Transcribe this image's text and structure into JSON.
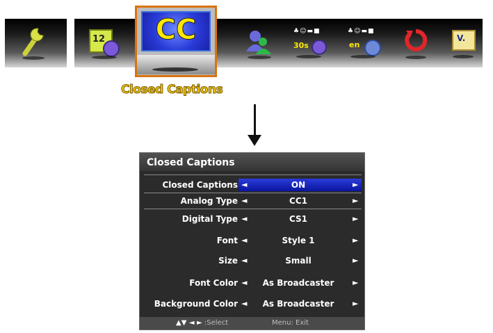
{
  "top_menu": {
    "items": [
      {
        "icon": "wrench-icon"
      },
      {
        "icon": "calendar-clock-icon",
        "text": "12"
      },
      {
        "icon": "closed-captions-icon",
        "text": "CC",
        "selected": true
      },
      {
        "icon": "user-icon"
      },
      {
        "icon": "sleep-timer-icon",
        "text": "30s"
      },
      {
        "icon": "language-icon",
        "text": "en"
      },
      {
        "icon": "reset-icon"
      },
      {
        "icon": "version-icon",
        "text": "V."
      }
    ],
    "selected_label": "Closed Captions"
  },
  "panel": {
    "title": "Closed Captions",
    "rows": [
      {
        "label": "Closed Captions",
        "value": "ON"
      },
      {
        "label": "Analog Type",
        "value": "CC1"
      },
      {
        "label": "Digital Type",
        "value": "CS1"
      },
      {
        "label": "Font",
        "value": "Style 1"
      },
      {
        "label": "Size",
        "value": "Small"
      },
      {
        "label": "Font Color",
        "value": "As Broadcaster"
      },
      {
        "label": "Background Color",
        "value": "As Broadcaster"
      }
    ],
    "arrow_left": "◄",
    "arrow_right": "►",
    "footer_keys": "▲▼ ◄ ►",
    "footer_select": ":Select",
    "footer_exit": "Menu: Exit"
  },
  "colors": {
    "selection": "#1726c8",
    "frame": "#d9730e",
    "caption": "#f3c900",
    "panel_bg": "#2b2b2b"
  }
}
